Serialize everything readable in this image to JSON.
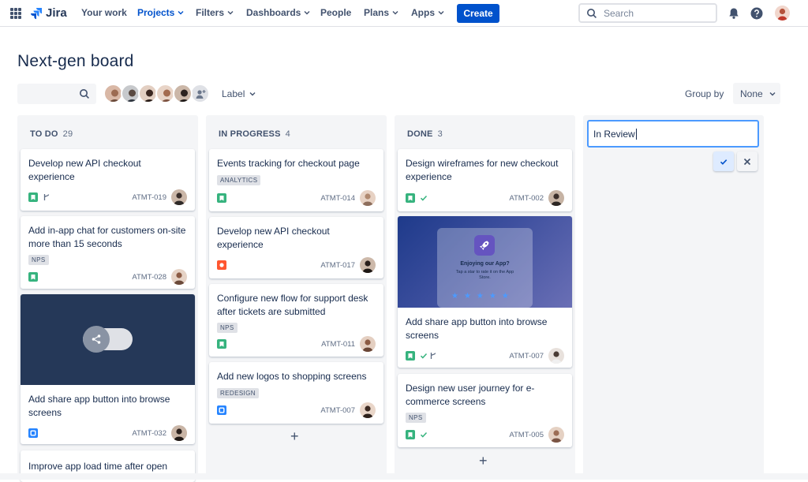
{
  "topnav": {
    "app_name": "Jira",
    "items": [
      {
        "label": "Your work"
      },
      {
        "label": "Projects"
      },
      {
        "label": "Filters"
      },
      {
        "label": "Dashboards"
      },
      {
        "label": "People"
      },
      {
        "label": "Plans"
      },
      {
        "label": "Apps"
      }
    ],
    "create_label": "Create",
    "search_placeholder": "Search"
  },
  "page": {
    "title": "Next-gen board"
  },
  "toolbar": {
    "label_filter": "Label",
    "group_by_label": "Group by",
    "group_by_value": "None"
  },
  "columns": [
    {
      "name": "TO DO",
      "count": "29",
      "cards": [
        {
          "title": "Develop new API checkout experience",
          "key": "ATMT-019"
        },
        {
          "title": "Add in-app chat for customers on-site more than 15 seconds",
          "tag": "NPS",
          "key": "ATMT-028"
        },
        {
          "title": "Add share app button into browse screens",
          "key": "ATMT-032"
        },
        {
          "title": "Improve app load time after open"
        }
      ]
    },
    {
      "name": "IN PROGRESS",
      "count": "4",
      "cards": [
        {
          "title": "Events tracking for checkout page",
          "tag": "ANALYTICS",
          "key": "ATMT-014"
        },
        {
          "title": "Develop new API checkout experience",
          "key": "ATMT-017"
        },
        {
          "title": "Configure new flow for support desk after tickets are submitted",
          "tag": "NPS",
          "key": "ATMT-011"
        },
        {
          "title": "Add new logos to shopping screens",
          "tag": "REDESIGN",
          "key": "ATMT-007"
        }
      ]
    },
    {
      "name": "DONE",
      "count": "3",
      "cards": [
        {
          "title": "Design wireframes for new checkout experience",
          "key": "ATMT-002"
        },
        {
          "title": "Add share app button into browse screens",
          "key": "ATMT-007",
          "image": {
            "heading": "Enjoying our App?",
            "body": "Tap a star to rate it on the App Store."
          }
        },
        {
          "title": "Design new user journey for e-commerce screens",
          "tag": "NPS",
          "key": "ATMT-005"
        }
      ]
    }
  ],
  "new_column": {
    "value": "In Review"
  },
  "colors": {
    "brand": "#0052cc",
    "story": "#36b37e",
    "bug": "#ff5630",
    "task": "#2684ff",
    "focus": "#4c9aff"
  }
}
